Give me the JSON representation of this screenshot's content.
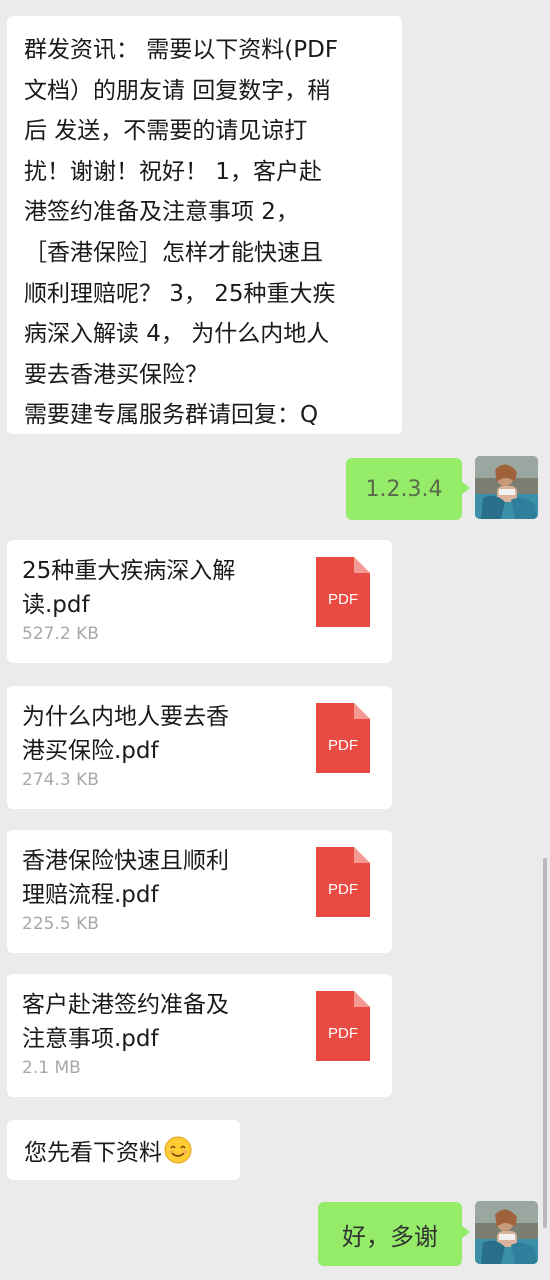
{
  "messages": {
    "broadcast_lines": [
      "群发资讯： 需要以下资料(PDF",
      "文档）的朋友请 回复数字，稍",
      "后 发送，不需要的请见谅打",
      "扰！谢谢！祝好！  1，客户赴",
      "港签约准备及注意事项 2，",
      "［香港保险］怎样才能快速且",
      "顺利理赔呢？ 3， 25种重大疾",
      "病深入解读 4， 为什么内地人",
      "要去香港买保险？",
      "需要建专属服务群请回复：Q"
    ],
    "reply_numbers": "1.2.3.4",
    "read_first": "您先看下资料",
    "thanks": "好，多谢"
  },
  "files": [
    {
      "name_lines": [
        "25种重大疾病深入解",
        "读.pdf"
      ],
      "size": "527.2 KB",
      "icon_label": "PDF"
    },
    {
      "name_lines": [
        "为什么内地人要去香",
        "港买保险.pdf"
      ],
      "size": "274.3 KB",
      "icon_label": "PDF"
    },
    {
      "name_lines": [
        "香港保险快速且顺利",
        "理赔流程.pdf"
      ],
      "size": "225.5 KB",
      "icon_label": "PDF"
    },
    {
      "name_lines": [
        "客户赴港签约准备及",
        "注意事项.pdf"
      ],
      "size": "2.1 MB",
      "icon_label": "PDF"
    }
  ],
  "icons": {
    "file_icon": "pdf-file-icon",
    "emoji": "smiling-face-emoji",
    "avatar": "user-avatar"
  },
  "colors": {
    "chat_background": "#ebebeb",
    "incoming_bubble": "#ffffff",
    "outgoing_bubble": "#95ec69",
    "pdf_red": "#e94a42"
  }
}
